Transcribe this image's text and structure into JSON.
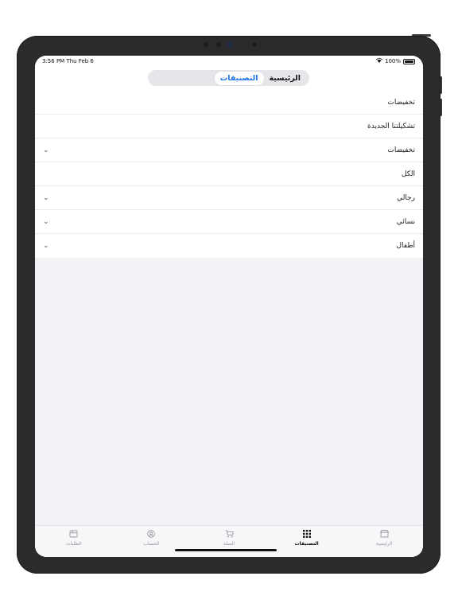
{
  "status": {
    "time": "3:56 PM  Thu Feb 6",
    "battery": "100%"
  },
  "segments": [
    {
      "label": "الرئيسية",
      "active": false
    },
    {
      "label": "التصنيفات",
      "active": true
    }
  ],
  "accent_color": "#1a73e8",
  "list": [
    {
      "label": "تخفيضات",
      "expandable": false
    },
    {
      "label": "تشكيلتنا الجديدة",
      "expandable": false
    },
    {
      "label": "تخفيضات",
      "expandable": true
    },
    {
      "label": "الكل",
      "expandable": false
    },
    {
      "label": "رجالي",
      "expandable": true
    },
    {
      "label": "نسائي",
      "expandable": true
    },
    {
      "label": "أطفال",
      "expandable": true
    }
  ],
  "chevron": "⌄",
  "tabs": [
    {
      "label": "الرئيسية",
      "icon": "store-icon",
      "active": false
    },
    {
      "label": "التصنيفات",
      "icon": "grid-icon",
      "active": true
    },
    {
      "label": "السلة",
      "icon": "cart-icon",
      "active": false
    },
    {
      "label": "الحساب",
      "icon": "account-icon",
      "active": false
    },
    {
      "label": "الطلبات",
      "icon": "orders-icon",
      "active": false
    }
  ]
}
